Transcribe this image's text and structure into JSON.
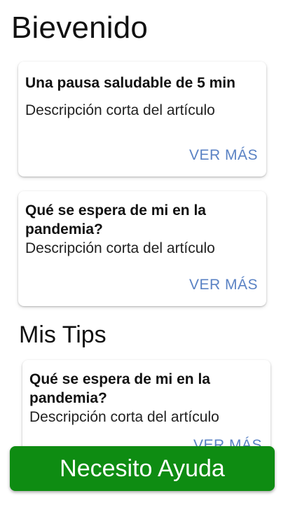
{
  "header": {
    "title": "Bievenido"
  },
  "articles": [
    {
      "title": "Una pausa saludable de 5 min",
      "description": "Descripción corta del artículo",
      "action": "VER MÁS"
    },
    {
      "title": "Qué se espera de mi en la pandemia?",
      "description": "Descripción corta del artículo",
      "action": "VER MÁS"
    }
  ],
  "tips_section": {
    "title": "Mis Tips",
    "items": [
      {
        "title": "Qué se espera de mi en la pandemia?",
        "description": "Descripción corta del artículo",
        "action": "VER MÁS"
      }
    ]
  },
  "help_button": {
    "label": "Necesito Ayuda",
    "color": "#0e8c12"
  },
  "colors": {
    "link": "#5a82c4",
    "background": "#ffffff"
  }
}
